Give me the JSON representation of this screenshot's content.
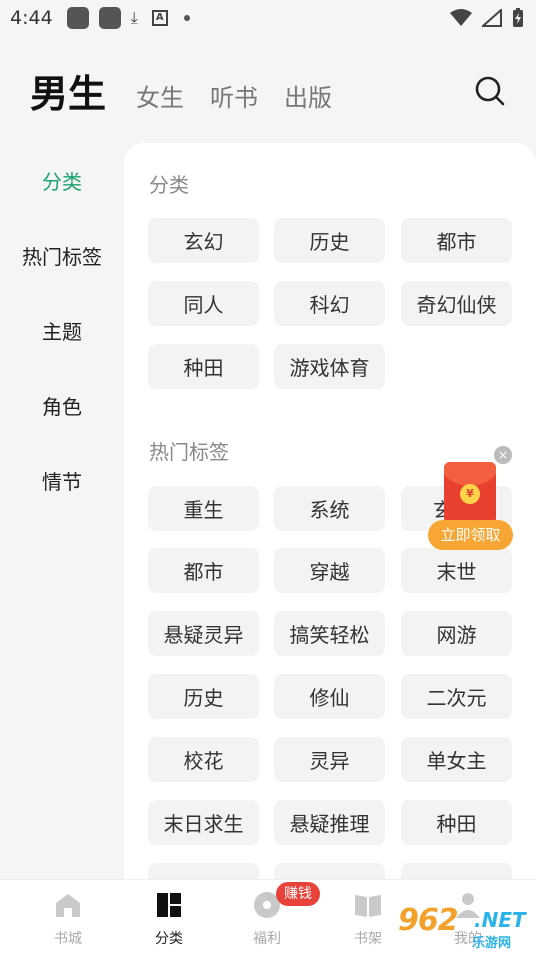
{
  "status_bar": {
    "time": "4:44"
  },
  "top_tabs": {
    "active": "男生",
    "others": [
      "女生",
      "听书",
      "出版"
    ]
  },
  "side_nav": {
    "items": [
      "分类",
      "热门标签",
      "主题",
      "角色",
      "情节"
    ],
    "active_index": 0
  },
  "sections": {
    "category": {
      "title": "分类",
      "chips": [
        "玄幻",
        "历史",
        "都市",
        "同人",
        "科幻",
        "奇幻仙侠",
        "种田",
        "游戏体育"
      ]
    },
    "hot_tags": {
      "title": "热门标签",
      "chips": [
        "重生",
        "系统",
        "玄",
        "都市",
        "穿越",
        "末世",
        "悬疑灵异",
        "搞笑轻松",
        "网游",
        "历史",
        "修仙",
        "二次元",
        "校花",
        "灵异",
        "单女主",
        "末日求生",
        "悬疑推理",
        "种田"
      ]
    }
  },
  "ad": {
    "button": "立即领取",
    "close": "×"
  },
  "bottom_nav": {
    "items": [
      "书城",
      "分类",
      "福利",
      "书架",
      "我的"
    ],
    "active_index": 1,
    "badge": "赚钱"
  },
  "watermark": {
    "logo": "962",
    "net": ".NET",
    "sub": "乐游网"
  },
  "colors": {
    "accent_green": "#1aa36d",
    "badge_red": "#e8423b",
    "ad_orange": "#f7a633"
  }
}
